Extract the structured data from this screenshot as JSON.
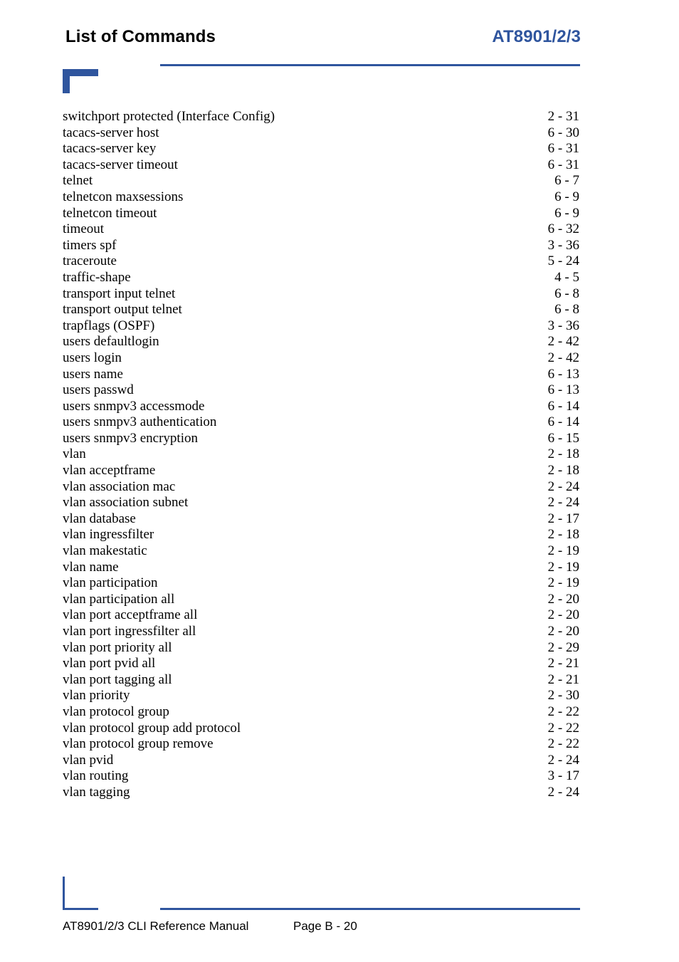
{
  "header": {
    "title": "List of Commands",
    "model": "AT8901/2/3",
    "accent_color": "#2F559E"
  },
  "index": {
    "entries": [
      {
        "label": "switchport protected (Interface Config)",
        "page": "2 - 31"
      },
      {
        "label": "tacacs-server host",
        "page": "6 - 30"
      },
      {
        "label": "tacacs-server key",
        "page": "6 - 31"
      },
      {
        "label": "tacacs-server timeout",
        "page": "6 - 31"
      },
      {
        "label": "telnet",
        "page": "6 - 7"
      },
      {
        "label": "telnetcon maxsessions",
        "page": "6 - 9"
      },
      {
        "label": "telnetcon timeout",
        "page": "6 - 9"
      },
      {
        "label": "timeout",
        "page": "6 - 32"
      },
      {
        "label": "timers spf",
        "page": "3 - 36"
      },
      {
        "label": "traceroute",
        "page": "5 - 24"
      },
      {
        "label": "traffic-shape",
        "page": "4 - 5"
      },
      {
        "label": "transport input telnet",
        "page": "6 - 8"
      },
      {
        "label": "transport output telnet",
        "page": "6 - 8"
      },
      {
        "label": "trapflags (OSPF)",
        "page": "3 - 36"
      },
      {
        "label": "users defaultlogin",
        "page": "2 - 42"
      },
      {
        "label": "users login",
        "page": "2 - 42"
      },
      {
        "label": "users name",
        "page": "6 - 13"
      },
      {
        "label": "users passwd",
        "page": "6 - 13"
      },
      {
        "label": "users snmpv3 accessmode",
        "page": "6 - 14"
      },
      {
        "label": "users snmpv3 authentication",
        "page": "6 - 14"
      },
      {
        "label": "users snmpv3 encryption",
        "page": "6 - 15"
      },
      {
        "label": "vlan",
        "page": "2 - 18"
      },
      {
        "label": "vlan acceptframe",
        "page": "2 - 18"
      },
      {
        "label": "vlan association mac",
        "page": "2 - 24"
      },
      {
        "label": "vlan association subnet",
        "page": "2 - 24"
      },
      {
        "label": "vlan database",
        "page": "2 - 17"
      },
      {
        "label": "vlan ingressfilter",
        "page": "2 - 18"
      },
      {
        "label": "vlan makestatic",
        "page": "2 - 19"
      },
      {
        "label": "vlan name",
        "page": "2 - 19"
      },
      {
        "label": "vlan participation",
        "page": "2 - 19"
      },
      {
        "label": "vlan participation all",
        "page": "2 - 20"
      },
      {
        "label": "vlan port acceptframe all",
        "page": "2 - 20"
      },
      {
        "label": "vlan port ingressfilter all",
        "page": "2 - 20"
      },
      {
        "label": "vlan port priority all",
        "page": "2 - 29"
      },
      {
        "label": "vlan port pvid all",
        "page": "2 - 21"
      },
      {
        "label": "vlan port tagging all",
        "page": "2 - 21"
      },
      {
        "label": "vlan priority",
        "page": "2 - 30"
      },
      {
        "label": "vlan protocol group",
        "page": "2 - 22"
      },
      {
        "label": "vlan protocol group add protocol",
        "page": "2 - 22"
      },
      {
        "label": "vlan protocol group remove",
        "page": "2 - 22"
      },
      {
        "label": "vlan pvid",
        "page": "2 - 24"
      },
      {
        "label": "vlan routing",
        "page": "3 - 17"
      },
      {
        "label": "vlan tagging",
        "page": "2 - 24"
      }
    ]
  },
  "footer": {
    "manual": "AT8901/2/3 CLI Reference Manual",
    "page_number": "Page B - 20"
  }
}
